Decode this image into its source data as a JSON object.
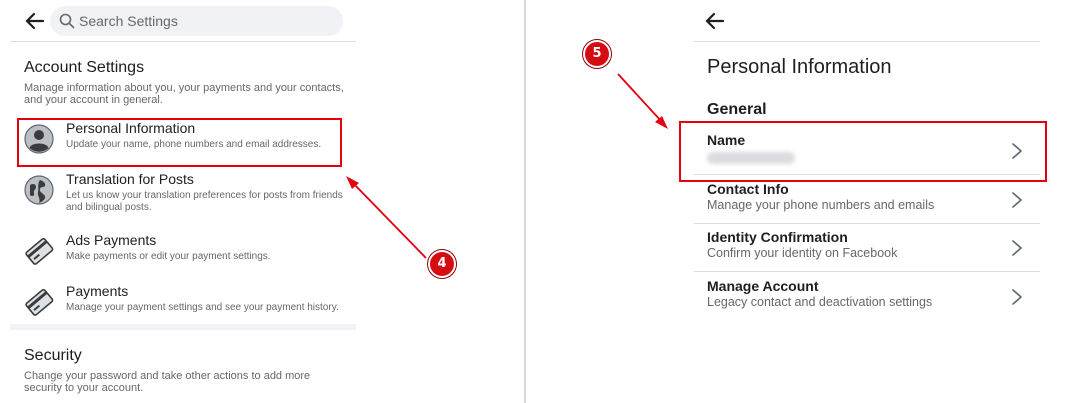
{
  "left_panel": {
    "search_placeholder": "Search Settings",
    "account_settings": {
      "title": "Account Settings",
      "description": "Manage information about you, your payments and your contacts, and your account in general.",
      "items": [
        {
          "title": "Personal Information",
          "subtitle": "Update your name, phone numbers and email addresses.",
          "icon": "person-icon"
        },
        {
          "title": "Translation for Posts",
          "subtitle": "Let us know your translation preferences for posts from friends and bilingual posts.",
          "icon": "globe-icon"
        },
        {
          "title": "Ads Payments",
          "subtitle": "Make payments or edit your payment settings.",
          "icon": "credit-card-icon"
        },
        {
          "title": "Payments",
          "subtitle": "Manage your payment settings and see your payment history.",
          "icon": "credit-card-icon"
        }
      ]
    },
    "security": {
      "title": "Security",
      "description": "Change your password and take other actions to add more security to your account."
    }
  },
  "annotations": {
    "step_left": "4",
    "step_right": "5",
    "highlight_color": "#e3000f"
  },
  "right_panel": {
    "title": "Personal Information",
    "section": "General",
    "rows": [
      {
        "title": "Name",
        "subtitle": ""
      },
      {
        "title": "Contact Info",
        "subtitle": "Manage your phone numbers and emails"
      },
      {
        "title": "Identity Confirmation",
        "subtitle": "Confirm your identity on Facebook"
      },
      {
        "title": "Manage Account",
        "subtitle": "Legacy contact and deactivation settings"
      }
    ]
  }
}
